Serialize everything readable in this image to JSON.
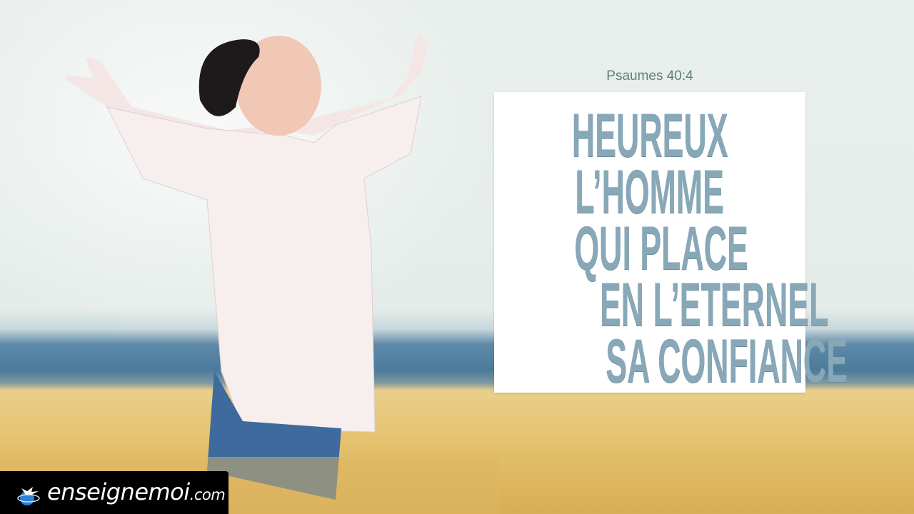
{
  "reference": "Psaumes 40:4",
  "verse_lines": [
    "HEUREUX",
    "L’HOMME",
    "QUI PLACE",
    "EN L’ETERNEL",
    "SA CONFIANCE"
  ],
  "logo": {
    "name": "enseignemoi",
    "tld": ".com"
  },
  "colors": {
    "verse": "#88a8b8",
    "reference": "#5d8078",
    "card": "#ffffff"
  }
}
